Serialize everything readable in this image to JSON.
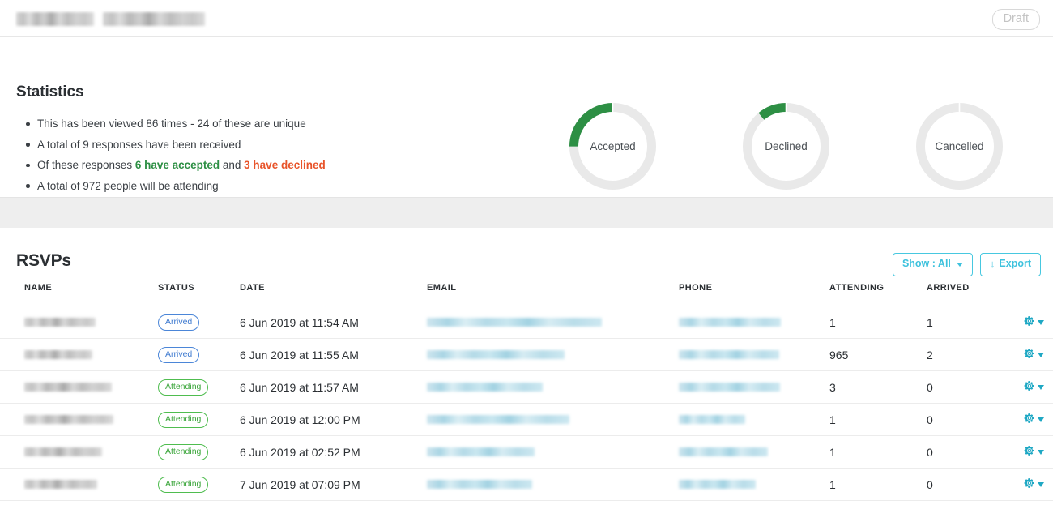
{
  "header": {
    "title_redacted": true,
    "title_block_widths": [
      96,
      126
    ],
    "status_badge": "Draft"
  },
  "statistics": {
    "heading": "Statistics",
    "bullets": [
      {
        "id": "views",
        "text": "This has been viewed 86 times - 24 of these are unique"
      },
      {
        "id": "responses",
        "text": "A total of 9 responses have been received"
      },
      {
        "id": "breakdown",
        "prefix": "Of these responses ",
        "accepted": "6 have accepted",
        "middle": " and ",
        "declined": "3 have declined"
      },
      {
        "id": "attending",
        "text": "A total of 972 people will be attending"
      }
    ],
    "metrics": {
      "views_total": 86,
      "views_unique": 24,
      "responses_total": 9,
      "accepted": 6,
      "declined": 3,
      "people_attending": 972
    }
  },
  "chart_data": {
    "type": "pie",
    "title": "RSVP response donuts",
    "legend_position": "center-inside",
    "colors": {
      "filled": "#2d8f44",
      "track": "#e9e9e9"
    },
    "charts": [
      {
        "label": "Accepted",
        "value": 6,
        "total": 24,
        "percent": 25,
        "filled_color": "#2d8f44",
        "track_color": "#e9e9e9"
      },
      {
        "label": "Declined",
        "value": 3,
        "total": 24,
        "percent": 11,
        "filled_color": "#2d8f44",
        "track_color": "#e9e9e9"
      },
      {
        "label": "Cancelled",
        "value": 0,
        "total": 24,
        "percent": 0,
        "filled_color": "#2d8f44",
        "track_color": "#e9e9e9"
      }
    ]
  },
  "rsvp": {
    "heading": "RSVPs",
    "show_filter": {
      "label": "Show : All",
      "icon": "chevron-down-icon"
    },
    "export": {
      "label": "Export",
      "icon": "download-arrow-icon",
      "glyph": "↓"
    },
    "columns": [
      "NAME",
      "STATUS",
      "DATE",
      "EMAIL",
      "PHONE",
      "ATTENDING",
      "ARRIVED"
    ],
    "rows": [
      {
        "name_redacted_width": 88,
        "status": "Arrived",
        "status_type": "arrived",
        "date": "6 Jun 2019 at 11:54 AM",
        "email_redacted_width": 216,
        "phone_redacted_width": 126,
        "attending": "1",
        "arrived": "1",
        "actions_icon": "gear-icon"
      },
      {
        "name_redacted_width": 84,
        "status": "Arrived",
        "status_type": "arrived",
        "date": "6 Jun 2019 at 11:55 AM",
        "email_redacted_width": 170,
        "phone_redacted_width": 124,
        "attending": "965",
        "arrived": "2",
        "actions_icon": "gear-icon"
      },
      {
        "name_redacted_width": 108,
        "status": "Attending",
        "status_type": "attending",
        "date": "6 Jun 2019 at 11:57 AM",
        "email_redacted_width": 143,
        "phone_redacted_width": 125,
        "attending": "3",
        "arrived": "0",
        "actions_icon": "gear-icon"
      },
      {
        "name_redacted_width": 110,
        "status": "Attending",
        "status_type": "attending",
        "date": "6 Jun 2019 at 12:00 PM",
        "email_redacted_width": 176,
        "phone_redacted_width": 82,
        "attending": "1",
        "arrived": "0",
        "actions_icon": "gear-icon"
      },
      {
        "name_redacted_width": 96,
        "status": "Attending",
        "status_type": "attending",
        "date": "6 Jun 2019 at 02:52 PM",
        "email_redacted_width": 133,
        "phone_redacted_width": 110,
        "attending": "1",
        "arrived": "0",
        "actions_icon": "gear-icon"
      },
      {
        "name_redacted_width": 90,
        "status": "Attending",
        "status_type": "attending",
        "date": "7 Jun 2019 at 07:09 PM",
        "email_redacted_width": 130,
        "phone_redacted_width": 95,
        "attending": "1",
        "arrived": "0",
        "actions_icon": "gear-icon"
      }
    ]
  },
  "colors": {
    "accent_teal": "#3ec2dd",
    "gear_teal": "#1fa8c4",
    "accepted_green": "#2d8f44",
    "declined_orange": "#e8542a",
    "pill_blue": "#3d79cf",
    "pill_green": "#3aa53a",
    "band_gray": "#eeeeee"
  }
}
